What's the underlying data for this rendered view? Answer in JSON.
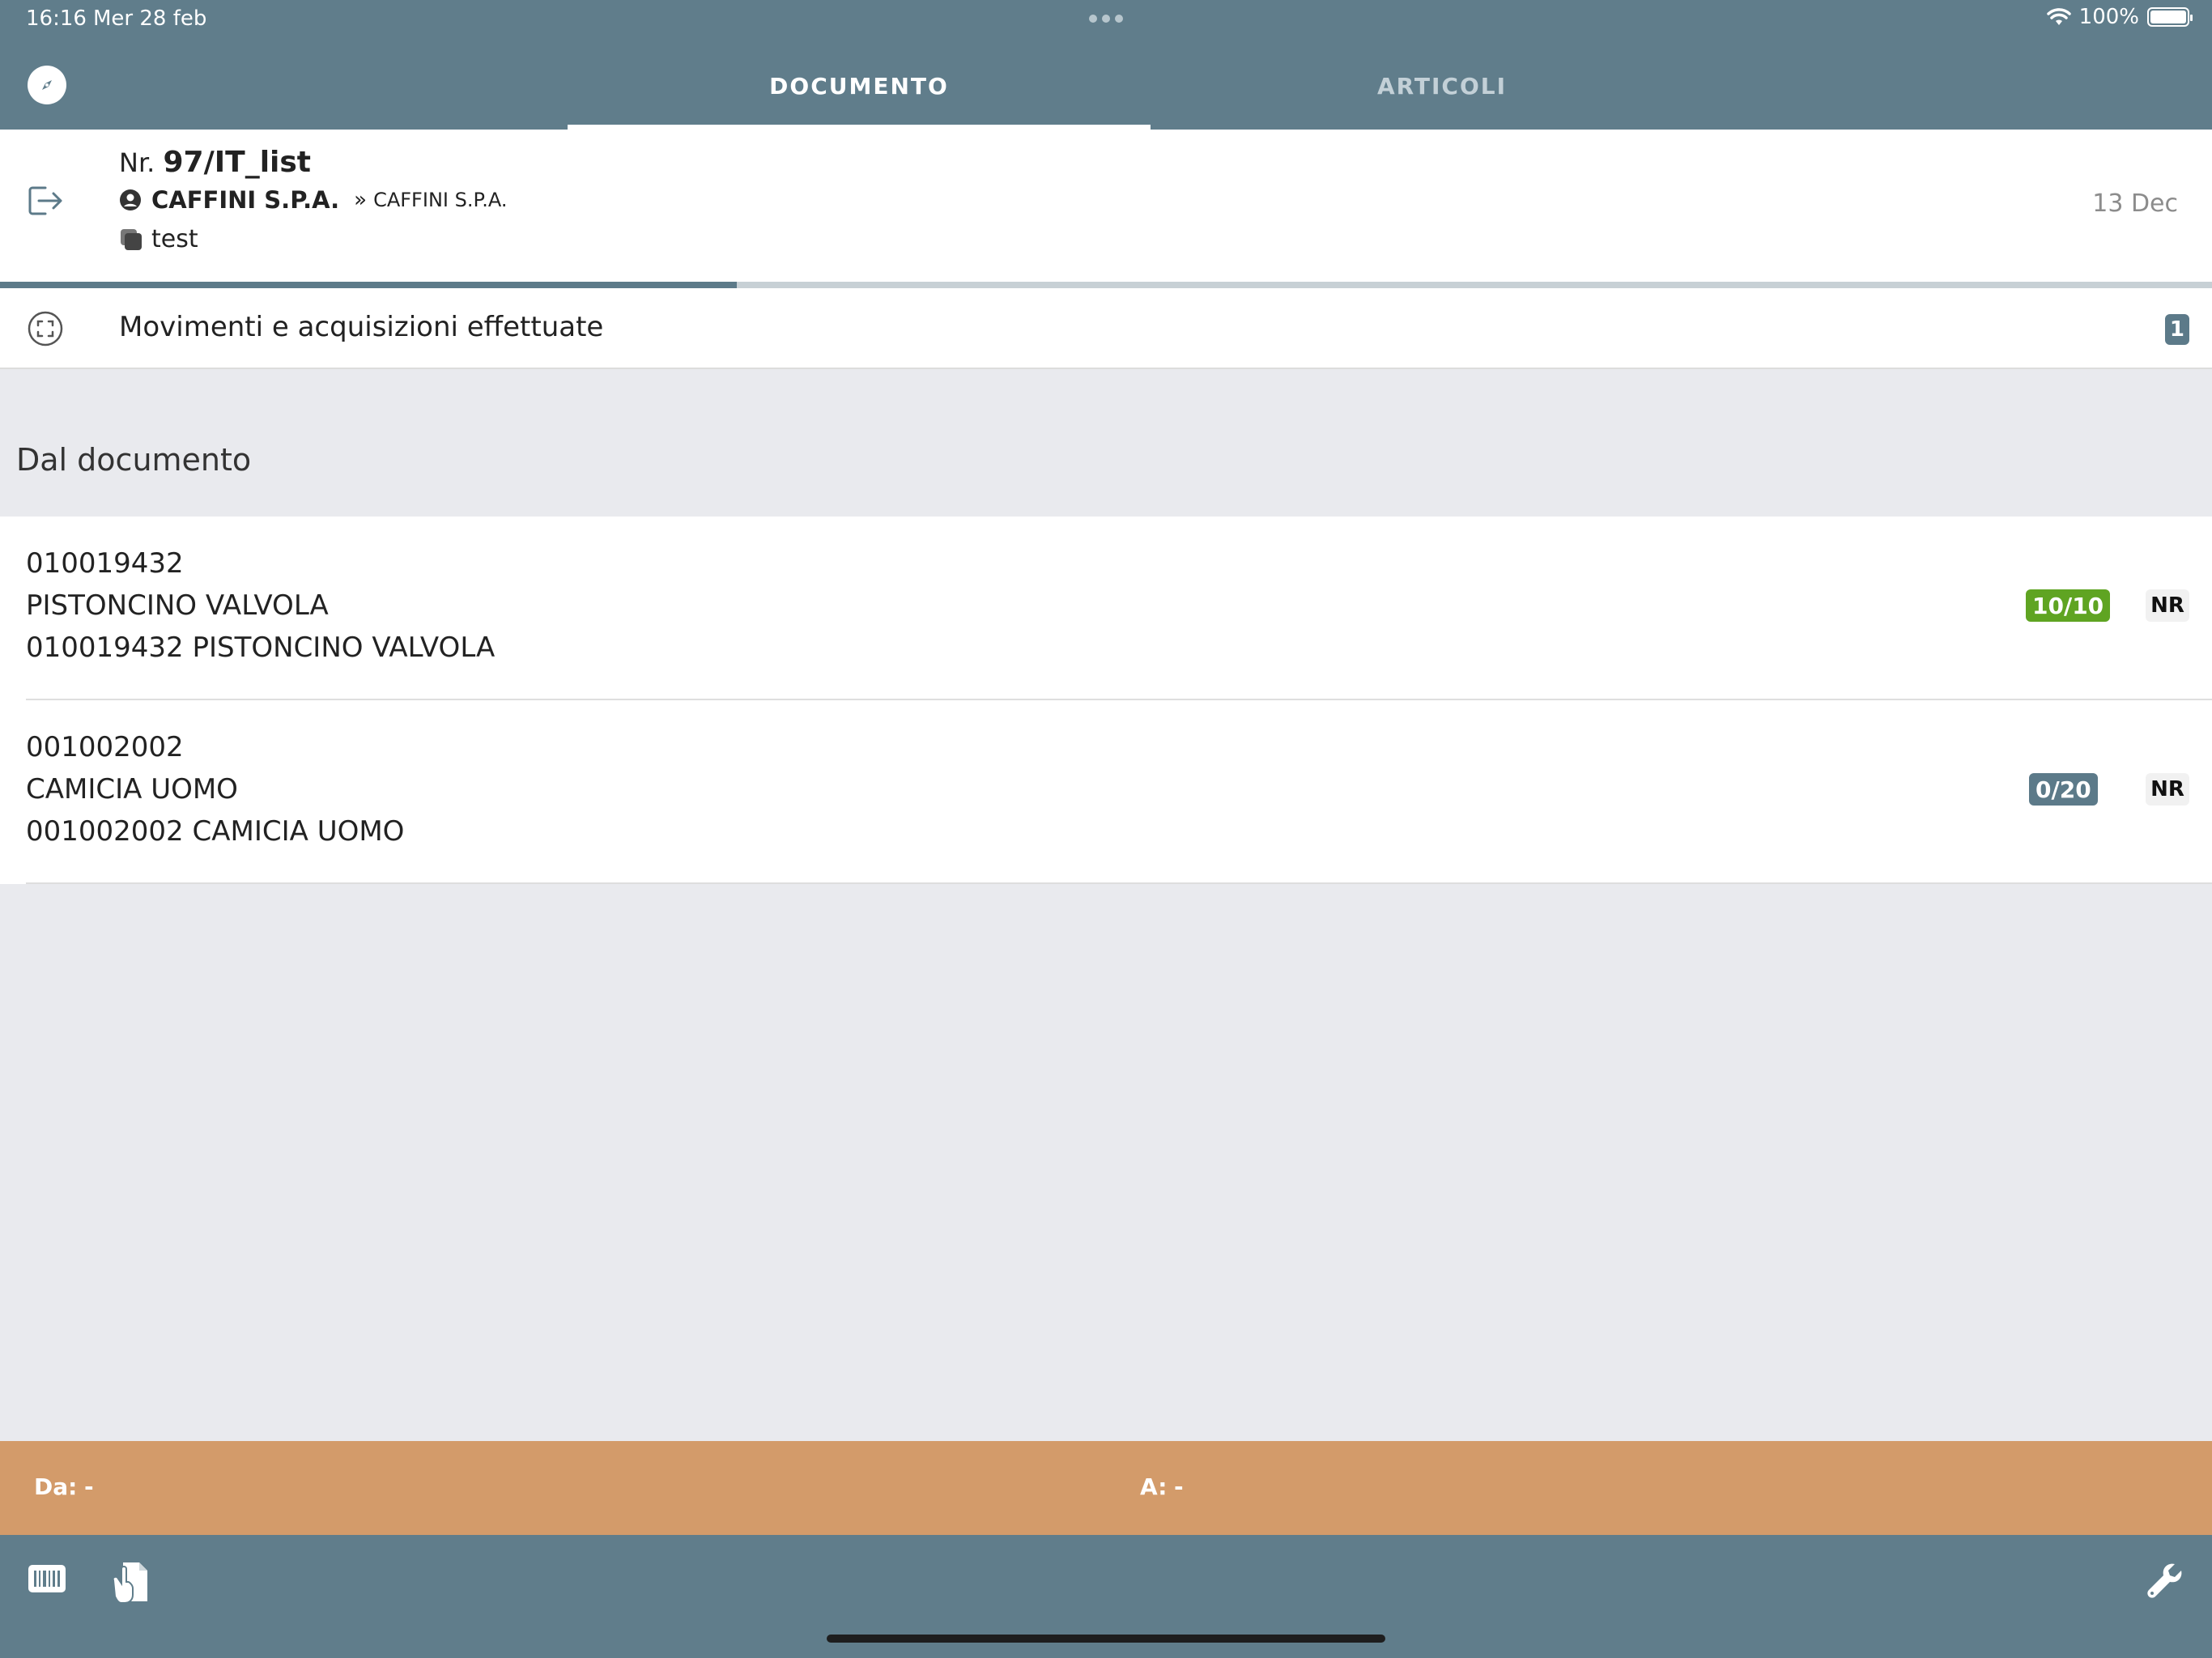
{
  "status_bar": {
    "time": "16:16",
    "date": "Mer 28 feb",
    "battery_percent": "100%"
  },
  "nav": {
    "tabs": [
      {
        "label": "DOCUMENTO",
        "active": true
      },
      {
        "label": "ARTICOLI",
        "active": false
      }
    ]
  },
  "document": {
    "number_prefix": "Nr.",
    "number": "97/IT_list",
    "customer": "CAFFINI S.P.A.",
    "arrow": "»",
    "destination": "CAFFINI S.P.A.",
    "note": "test",
    "date": "13 Dec",
    "progress_fraction": 0.333
  },
  "movements": {
    "label": "Movimenti e acquisizioni effettuate",
    "count": "1"
  },
  "section": {
    "title": "Dal documento"
  },
  "items": [
    {
      "code": "010019432",
      "name": "PISTONCINO VALVOLA",
      "description": "010019432 PISTONCINO VALVOLA",
      "quantity": "10/10",
      "quantity_color": "#5fa422",
      "flag": "NR"
    },
    {
      "code": "001002002",
      "name": "CAMICIA UOMO",
      "description": "001002002 CAMICIA UOMO",
      "quantity": "0/20",
      "quantity_color": "#5c7a89",
      "flag": "NR"
    }
  ],
  "range_bar": {
    "from_label": "Da:",
    "from_value": "-",
    "to_label": "A:",
    "to_value": "-"
  },
  "toolbar": {
    "icons": [
      "barcode-icon",
      "hand-document-icon",
      "wrench-icon"
    ]
  },
  "colors": {
    "header": "#607d8b",
    "accent": "#5c7a89",
    "range_bar": "#d39b6a",
    "complete_badge": "#5fa422"
  }
}
